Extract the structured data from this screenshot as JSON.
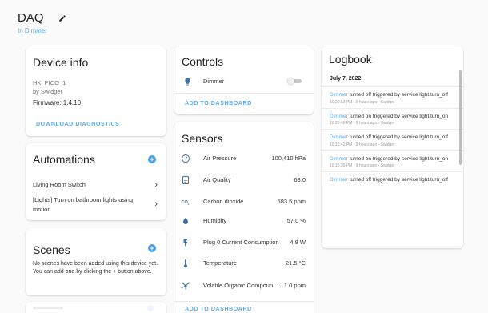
{
  "header": {
    "title": "DAQ",
    "area": "In Dimmer",
    "edit_icon": "pencil-icon"
  },
  "device_info": {
    "title": "Device info",
    "name": "HK_PICO_1",
    "by": "by Swidget",
    "firmware": "Firmware: 1.4.10",
    "button": "DOWNLOAD DIAGNOSTICS"
  },
  "automations": {
    "title": "Automations",
    "items": [
      {
        "label": "Living Room Switch"
      },
      {
        "label": "[Lights] Turn on bathroom lights using motion"
      }
    ]
  },
  "scenes": {
    "title": "Scenes",
    "empty_text": "No scenes have been added using this device yet. You can add one by clicking the + button above."
  },
  "controls": {
    "title": "Controls",
    "entities": [
      {
        "name": "Dimmer",
        "icon": "lightbulb-icon",
        "state": "off"
      }
    ],
    "button": "ADD TO DASHBOARD"
  },
  "sensors": {
    "title": "Sensors",
    "items": [
      {
        "name": "Air Pressure",
        "value": "100,410 hPa",
        "icon": "gauge-icon"
      },
      {
        "name": "Air Quality",
        "value": "68.0",
        "icon": "air-quality-icon"
      },
      {
        "name": "Carbon dioxide",
        "value": "683.5 ppm",
        "icon": "co2-icon"
      },
      {
        "name": "Humidity",
        "value": "57.0 %",
        "icon": "water-drop-icon"
      },
      {
        "name": "Plug 0 Current Consumption",
        "value": "4.8 W",
        "icon": "flash-icon"
      },
      {
        "name": "Temperature",
        "value": "21.5 °C",
        "icon": "thermometer-icon"
      },
      {
        "name": "Volatile Organic Compoun...",
        "value": "1.0 ppm",
        "icon": "molecule-icon"
      }
    ],
    "button": "ADD TO DASHBOARD"
  },
  "logbook": {
    "title": "Logbook",
    "date": "July 7, 2022",
    "entries": [
      {
        "entity": "Dimmer",
        "message": "turned off triggered by service light.turn_off",
        "time": "10:20:52 PM - 9 hours ago - Swidget"
      },
      {
        "entity": "Dimmer",
        "message": "turned on triggered by service light.turn_on",
        "time": "10:20:49 PM - 9 hours ago - Swidget"
      },
      {
        "entity": "Dimmer",
        "message": "turned off triggered by service light.turn_off",
        "time": "10:15:42 PM - 9 hours ago - Swidget"
      },
      {
        "entity": "Dimmer",
        "message": "turned on triggered by service light.turn_on",
        "time": "10:15:39 PM - 9 hours ago - Swidget"
      },
      {
        "entity": "Dimmer",
        "message": "turned off triggered by service light.turn_off",
        "time": ""
      }
    ]
  },
  "colors": {
    "accent": "#4a9fe0",
    "link": "#5aa8e8",
    "background": "#fafafa"
  }
}
